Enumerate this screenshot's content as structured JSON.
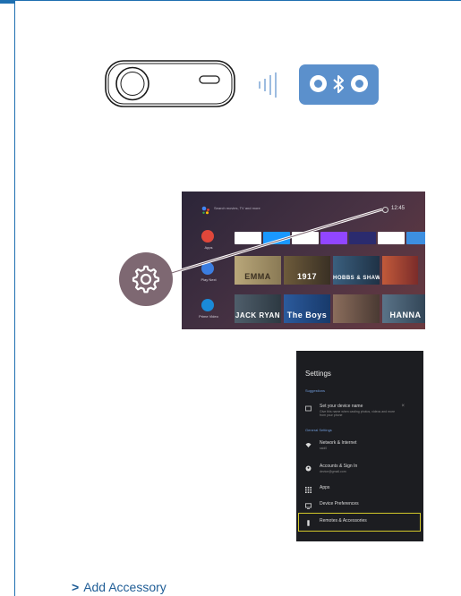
{
  "tv": {
    "search_text": "Search movies, TV and more",
    "clock": "12:45",
    "apps_label": "Apps",
    "playnext_label": "Play Next",
    "primevideo_label": "Prime Video",
    "app_tiles": [
      "YouTube",
      "prime video",
      "Google Play Movies",
      "twitch",
      "Plex",
      "Play Store",
      "Home"
    ],
    "row1_posters": [
      "EMMA",
      "1917",
      "HOBBS & SHAW"
    ],
    "row2_posters": [
      "JACK RYAN",
      "The Boys",
      "HANNA"
    ]
  },
  "settings": {
    "title": "Settings",
    "suggestions_header": "Suggestions",
    "suggestion_title": "Set your device name",
    "suggestion_sub": "Give this name when casting photos, videos and more from your phone",
    "general_header": "General Settings",
    "items": [
      {
        "label": "Network & Internet",
        "sub": "ssid0"
      },
      {
        "label": "Accounts & Sign In",
        "sub": "device@gmail.com"
      },
      {
        "label": "Apps",
        "sub": ""
      },
      {
        "label": "Device Preferences",
        "sub": ""
      },
      {
        "label": "Remotes & Accessories",
        "sub": ""
      }
    ]
  },
  "step": {
    "arrow": ">",
    "text": "Add Accessory"
  },
  "colors": {
    "accent": "#1e6fb0",
    "bluetooth": "#5b90cc",
    "gear_circle": "#7e6872",
    "highlight": "#d2c72a"
  }
}
